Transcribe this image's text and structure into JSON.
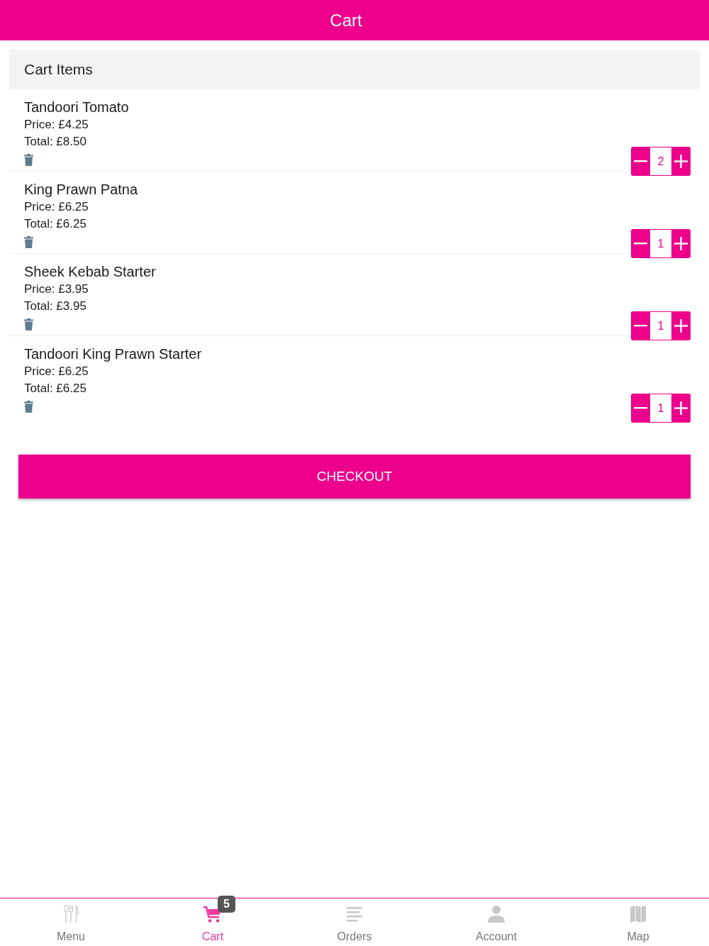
{
  "header": {
    "title": "Cart"
  },
  "cart": {
    "heading": "Cart Items",
    "items": [
      {
        "name": "Tandoori Tomato",
        "price": "Price: £4.25",
        "total": "Total: £8.50",
        "quantity": "2"
      },
      {
        "name": "King Prawn Patna",
        "price": "Price: £6.25",
        "total": "Total: £6.25",
        "quantity": "1"
      },
      {
        "name": "Sheek Kebab Starter",
        "price": "Price: £3.95",
        "total": "Total: £3.95",
        "quantity": "1"
      },
      {
        "name": "Tandoori King Prawn Starter",
        "price": "Price: £6.25",
        "total": "Total: £6.25",
        "quantity": "1"
      }
    ]
  },
  "checkout_button": {
    "label": "CHECKOUT"
  },
  "tab_bar": {
    "tabs": [
      {
        "label": "Menu",
        "selected": false
      },
      {
        "label": "Cart",
        "selected": true,
        "badge": "5"
      },
      {
        "label": "Orders",
        "selected": false
      },
      {
        "label": "Account",
        "selected": false
      },
      {
        "label": "Map",
        "selected": false
      }
    ]
  }
}
